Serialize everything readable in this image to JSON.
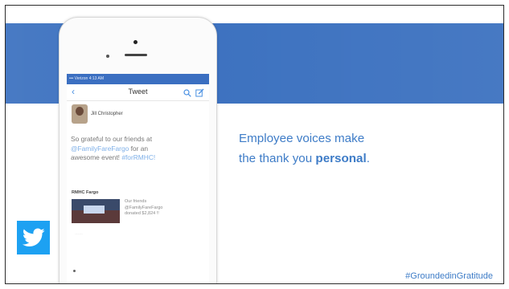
{
  "phone": {
    "status_text": "••• Verizon 4:13 AM",
    "nav": {
      "back": "‹",
      "title": "Tweet"
    },
    "author_name": "Jill Christopher",
    "tweet": {
      "line1": "So grateful to our friends at",
      "line2_link": "@FamilyFareFargo",
      "line2_rest": " for an",
      "line3_prefix": "awesome event! ",
      "line3_link": "#forRMHC!"
    },
    "card": {
      "title": "RMHC Fargo",
      "lines": [
        "Our friends",
        "@FamilyFareFargo",
        "donated $2,824 !!"
      ]
    },
    "faint_text": "……"
  },
  "message": {
    "line1": "Employee voices make",
    "line2_prefix": "the thank you ",
    "line2_bold": "personal",
    "line2_suffix": "."
  },
  "hashtag": "#GroundedinGratitude",
  "colors": {
    "banner": "#3d72c0",
    "accent_text": "#3e7cc7",
    "twitter": "#1da1f2"
  },
  "icons": [
    "search-icon",
    "compose-icon",
    "twitter-bird-icon",
    "back-chevron-icon"
  ]
}
